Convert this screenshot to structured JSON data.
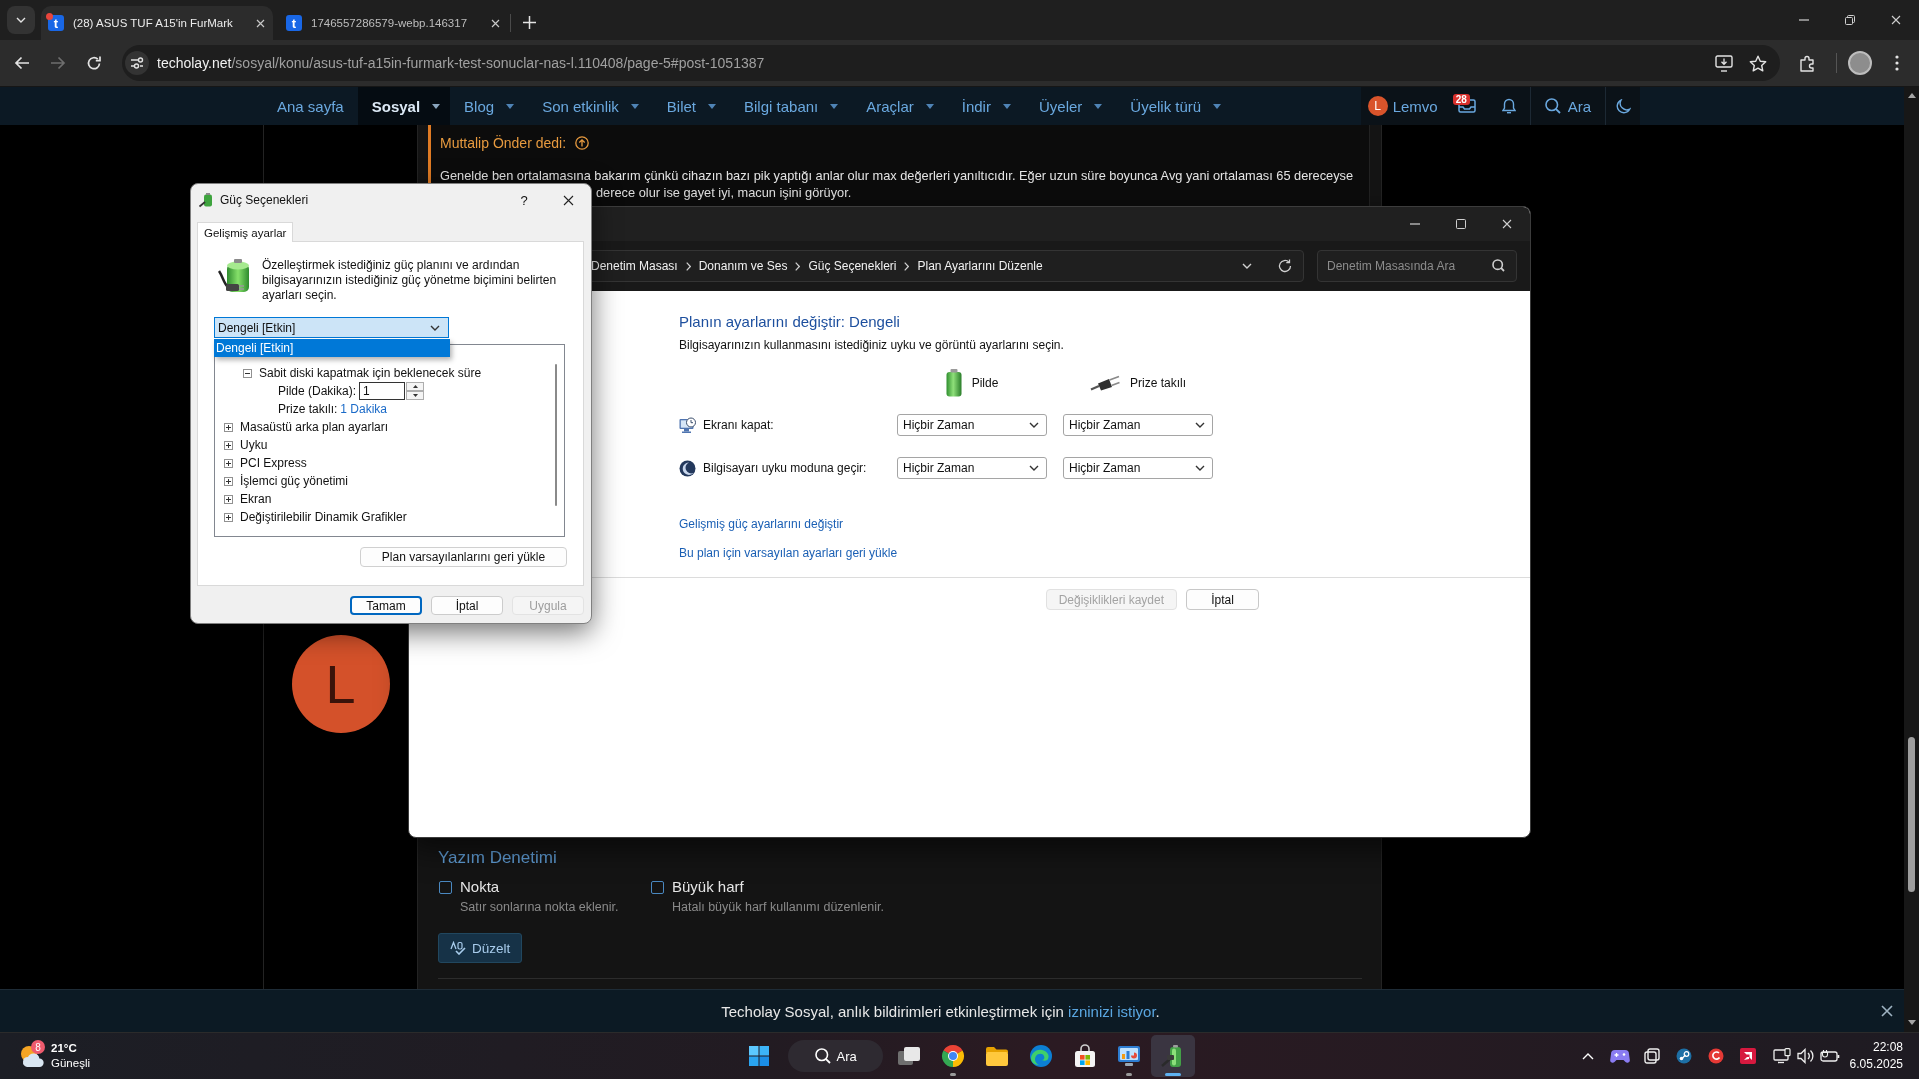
{
  "browser": {
    "tabs": [
      {
        "favicon": "t",
        "title": "(28) ASUS TUF A15'in FurMark",
        "selected": true,
        "notification": true
      },
      {
        "favicon": "t",
        "title": "1746557286579-webp.146317",
        "selected": false,
        "notification": false
      }
    ],
    "address": {
      "domain": "techolay.net",
      "path": "/sosyal/konu/asus-tuf-a15in-furmark-test-sonuclar-nas-l.110408/page-5#post-1051387"
    }
  },
  "site_nav": {
    "items": [
      {
        "label": "Ana sayfa",
        "selected": false,
        "has_menu": false
      },
      {
        "label": "Sosyal",
        "selected": true,
        "has_menu": true
      },
      {
        "label": "Blog",
        "selected": false,
        "has_menu": true
      },
      {
        "label": "Son etkinlik",
        "selected": false,
        "has_menu": true
      },
      {
        "label": "Bilet",
        "selected": false,
        "has_menu": true
      },
      {
        "label": "Bilgi tabanı",
        "selected": false,
        "has_menu": true
      },
      {
        "label": "Araçlar",
        "selected": false,
        "has_menu": true
      },
      {
        "label": "İndir",
        "selected": false,
        "has_menu": true
      },
      {
        "label": "Üyeler",
        "selected": false,
        "has_menu": true
      },
      {
        "label": "Üyelik türü",
        "selected": false,
        "has_menu": true
      }
    ],
    "user": {
      "initial": "L",
      "name": "Lemvo"
    },
    "inbox_badge": "28",
    "search": "Ara"
  },
  "post": {
    "avatar_initial": "L",
    "quote": {
      "author": "Muttalip Önder dedi:",
      "lines": [
        "Genelde ben ortalamasına bakarım çünkü cihazın bazı pik yaptığı anlar olur max değerleri yanıltıcıdır. Eğer uzun süre boyunca Avg yani ortalaması 65 dereceyse",
        "derece olur ise gayet iyi, macun işini görüyor."
      ]
    }
  },
  "spell_check": {
    "title": "Yazım Denetimi",
    "options": [
      {
        "label": "Nokta",
        "description": "Satır sonlarına nokta eklenir.",
        "checked": false
      },
      {
        "label": "Büyük harf",
        "description": "Hatalı büyük harf kullanımı düzenlenir.",
        "checked": false
      }
    ],
    "button": "Düzelt"
  },
  "notice": {
    "text": "Techolay Sosyal, anlık bildirimleri etkinleştirmek için ",
    "link": "izninizi istiyor",
    "after": "."
  },
  "control_panel": {
    "breadcrumb": [
      "Denetim Masası",
      "Donanım ve Ses",
      "Güç Seçenekleri",
      "Plan Ayarlarını Düzenle"
    ],
    "search_placeholder": "Denetim Masasında Ara",
    "heading": "Planın ayarlarını değiştir: Dengeli",
    "description": "Bilgisayarınızın kullanmasını istediğiniz uyku ve görüntü ayarlarını seçin.",
    "columns": [
      {
        "kind": "battery",
        "label": "Pilde"
      },
      {
        "kind": "plug",
        "label": "Prize takılı"
      }
    ],
    "rows": [
      {
        "kind": "display",
        "label": "Ekranı kapat:",
        "values": [
          "Hiçbir Zaman",
          "Hiçbir Zaman"
        ]
      },
      {
        "kind": "sleep",
        "label": "Bilgisayarı uyku moduna geçir:",
        "values": [
          "Hiçbir Zaman",
          "Hiçbir Zaman"
        ]
      }
    ],
    "links": [
      "Gelişmiş güç ayarlarını değiştir",
      "Bu plan için varsayılan ayarları geri yükle"
    ],
    "buttons": [
      {
        "label": "Değişiklikleri kaydet",
        "disabled": true
      },
      {
        "label": "İptal",
        "disabled": false
      }
    ]
  },
  "power_dialog": {
    "title": "Güç Seçenekleri",
    "help": "?",
    "tabs": [
      {
        "label": "Gelişmiş ayarlar",
        "selected": true
      }
    ],
    "intro": "Özelleştirmek istediğiniz güç planını ve ardından bilgisayarınızın istediğiniz güç yönetme biçimini belirten ayarları seçin.",
    "plan": {
      "value": "Dengeli [Etkin]",
      "expanded": true,
      "options": [
        {
          "label": "Dengeli [Etkin]",
          "selected": true
        }
      ]
    },
    "tree": [
      {
        "children": [
          {
            "label": "Sabit diski kapatmak için beklenecek süre",
            "expanded": true,
            "children": [
              {
                "kind": "spin",
                "label": "Pilde (Dakika):",
                "value": "1"
              },
              {
                "kind": "link",
                "label": "Prize takılı:",
                "value": "1 Dakika"
              }
            ]
          }
        ]
      },
      {
        "label": "Masaüstü arka plan ayarları",
        "expanded": false
      },
      {
        "label": "Uyku",
        "expanded": false
      },
      {
        "label": "PCI Express",
        "expanded": false
      },
      {
        "label": "İşlemci güç yönetimi",
        "expanded": false
      },
      {
        "label": "Ekran",
        "expanded": false
      },
      {
        "label": "Değiştirilebilir Dinamik Grafikler",
        "expanded": false
      }
    ],
    "restore_button": "Plan varsayılanlarını geri yükle",
    "buttons": [
      {
        "label": "Tamam",
        "default": true,
        "disabled": false
      },
      {
        "label": "İptal",
        "default": false,
        "disabled": false
      },
      {
        "label": "Uygula",
        "default": false,
        "disabled": true
      }
    ]
  },
  "taskbar": {
    "weather": {
      "badge": "8",
      "temperature": "21°C",
      "condition": "Güneşli"
    },
    "search": "Ara",
    "apps": [
      {
        "kind": "taskview",
        "running": false,
        "active": false
      },
      {
        "kind": "browser",
        "running": true,
        "active": false
      },
      {
        "kind": "folder",
        "running": false,
        "active": false
      },
      {
        "kind": "swirl",
        "running": false,
        "active": false
      },
      {
        "kind": "store",
        "running": false,
        "active": false
      },
      {
        "kind": "panel",
        "running": true,
        "active": false
      },
      {
        "kind": "battery",
        "running": true,
        "active": true
      }
    ],
    "clock": {
      "time": "22:08",
      "date": "6.05.2025"
    }
  }
}
